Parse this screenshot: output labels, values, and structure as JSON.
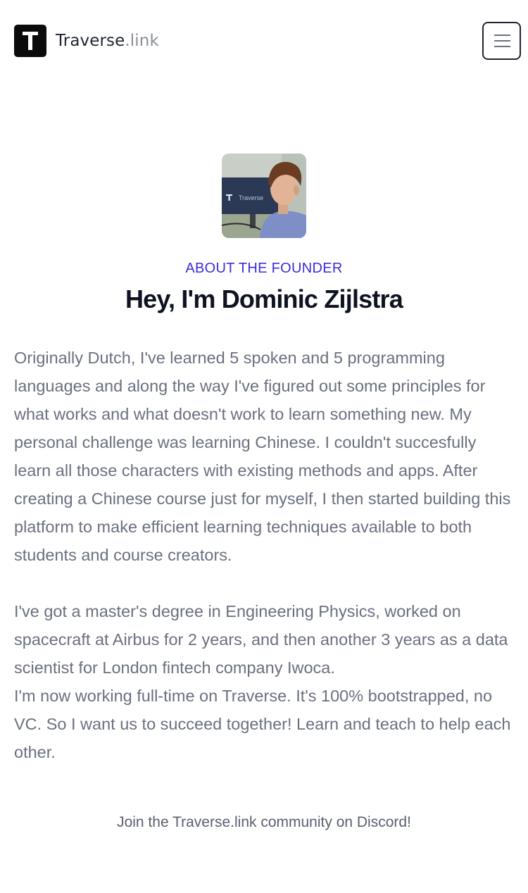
{
  "header": {
    "brand_main": "Traverse",
    "brand_suffix": ".link",
    "menu_icon": "hamburger-menu-icon"
  },
  "about": {
    "photo_overlay_text": "Traverse",
    "eyebrow": "ABOUT THE FOUNDER",
    "title": "Hey, I'm Dominic Zijlstra",
    "paragraph_1": "Originally Dutch, I've learned 5 spoken and 5 programming languages and along the way I've figured out some principles for what works and what doesn't work to learn something new. My personal challenge was learning Chinese. I couldn't succesfully learn all those characters with existing methods and apps. After creating a Chinese course just for myself, I then started building this platform to make efficient learning techniques available to both students and course creators.",
    "paragraph_2": "I've got a master's degree in Engineering Physics, worked on spacecraft at Airbus for 2 years, and then another 3 years as a data scientist for London fintech company Iwoca.",
    "paragraph_3": "I'm now working full-time on Traverse. It's 100% bootstrapped, no VC. So I want us to succeed together! Learn and teach to help each other."
  },
  "community": {
    "discord_link": "Join the Traverse.link community on Discord!"
  },
  "colors": {
    "accent": "#3a2cdb",
    "heading": "#0f1321",
    "body": "#6b7080"
  }
}
